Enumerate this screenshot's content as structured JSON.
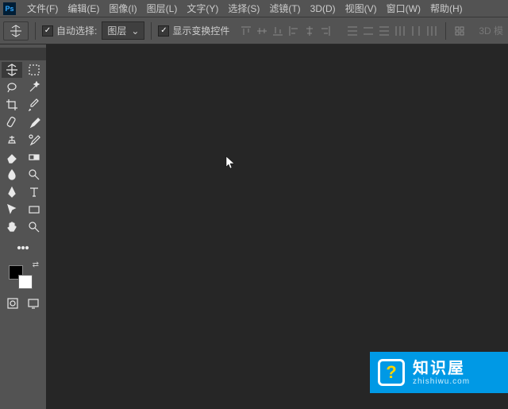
{
  "menu": {
    "file": "文件(F)",
    "edit": "编辑(E)",
    "image": "图像(I)",
    "layer": "图层(L)",
    "type": "文字(Y)",
    "select": "选择(S)",
    "filter": "滤镜(T)",
    "threeD": "3D(D)",
    "view": "视图(V)",
    "window": "窗口(W)",
    "help": "帮助(H)"
  },
  "options": {
    "autoSelect": "自动选择:",
    "layerDD": "图层",
    "showTransform": "显示变换控件",
    "threeDMode": "3D 模"
  },
  "logo": {
    "title": "知识屋",
    "domain": "zhishiwu.com"
  },
  "colors": {
    "fg": "#000000",
    "bg": "#ffffff"
  }
}
